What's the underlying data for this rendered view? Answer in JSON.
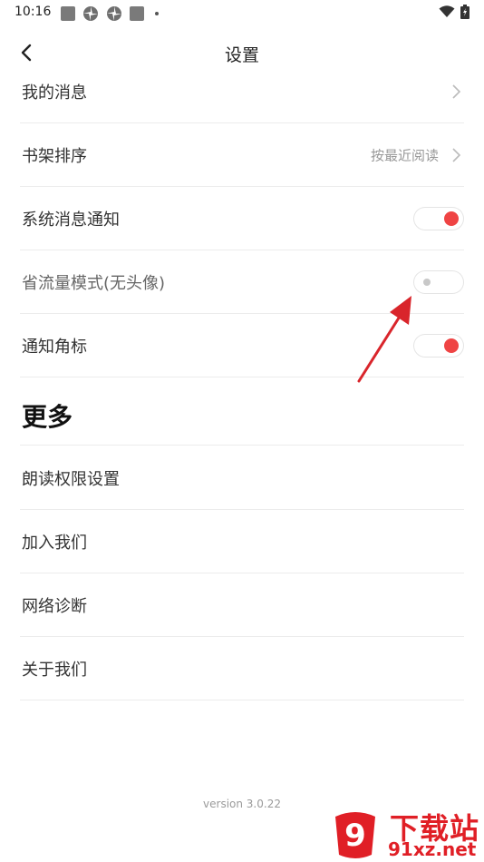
{
  "status_bar": {
    "time": "10:16"
  },
  "header": {
    "title": "设置"
  },
  "settings": [
    {
      "label": "我的消息",
      "control": "chevron"
    },
    {
      "label": "书架排序",
      "value": "按最近阅读",
      "control": "chevron"
    },
    {
      "label": "系统消息通知",
      "control": "toggle",
      "state": "on"
    },
    {
      "label": "省流量模式(无头像)",
      "control": "toggle",
      "state": "off"
    },
    {
      "label": "通知角标",
      "control": "toggle",
      "state": "on"
    }
  ],
  "more": {
    "heading": "更多",
    "items": [
      "朗读权限设置",
      "加入我们",
      "网络诊断",
      "关于我们"
    ]
  },
  "footer": {
    "version": "version 3.0.22"
  },
  "watermark": {
    "text": "下载站",
    "domain": "91xz.net",
    "badge": "9"
  },
  "colors": {
    "accent": "#ef4444",
    "annotation_arrow": "#d9252b"
  }
}
